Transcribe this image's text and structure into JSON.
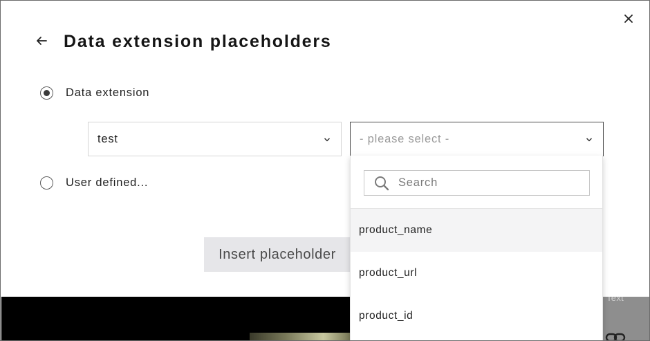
{
  "modal": {
    "title": "Data extension placeholders",
    "back_icon": "arrow-left-icon",
    "close_icon": "close-icon"
  },
  "options": {
    "data_extension_label": "Data extension",
    "data_extension_checked": true,
    "user_defined_label": "User defined...",
    "user_defined_checked": false
  },
  "data_extension_select": {
    "value": "test"
  },
  "field_select": {
    "placeholder": "- please select -",
    "expanded": true
  },
  "dropdown": {
    "search_placeholder": "Search",
    "items": [
      "product_name",
      "product_url",
      "product_id"
    ],
    "highlighted_index": 0
  },
  "actions": {
    "insert_label": "Insert placeholder"
  },
  "background": {
    "text_label": "Text",
    "link_icon": "link-icon"
  }
}
